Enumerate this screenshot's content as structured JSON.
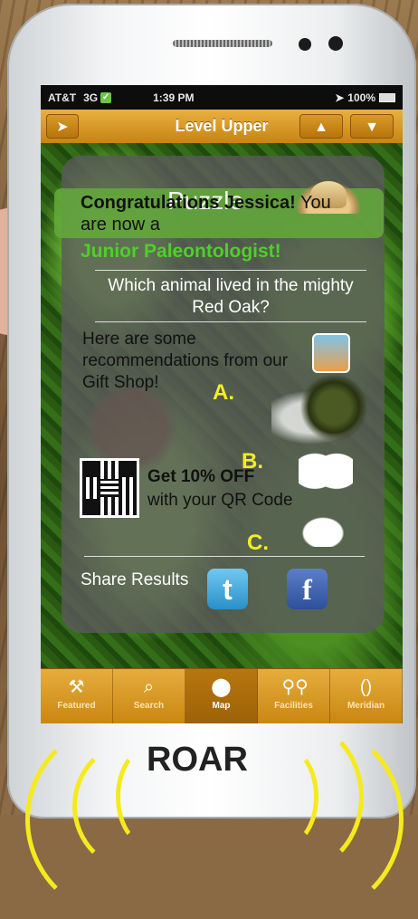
{
  "statusbar": {
    "carrier": "AT&T",
    "network": "3G",
    "time": "1:39 PM",
    "battery": "100%"
  },
  "navbar": {
    "title": "Level Upper",
    "up_arrow": "▲",
    "down_arrow": "▼",
    "location_icon": "➤"
  },
  "panel": {
    "puzzle_title": "Puzzle",
    "congrats_name": "Congratulations Jessica!",
    "congrats_rest": " You are now a",
    "achievement": "Junior Paleontologist!",
    "question": "Which animal lived in the mighty Red Oak?",
    "gift_text": "Here are some recommendations from our Gift Shop!",
    "option_a": "A.",
    "option_b": "B.",
    "option_c": "C.",
    "discount_bold": "Get 10% OFF",
    "discount_rest": "with your QR Code",
    "share_label": "Share Results",
    "twitter": "t",
    "facebook": "f"
  },
  "tabbar": {
    "items": [
      {
        "label": "Featured",
        "icon": "⚒"
      },
      {
        "label": "Search",
        "icon": "🔍"
      },
      {
        "label": "Map",
        "icon": "📍"
      },
      {
        "label": "Facilities",
        "icon": "🚻"
      },
      {
        "label": "Meridian",
        "icon": "()"
      }
    ]
  },
  "roar": {
    "label": "ROAR",
    "accent_color": "#f5ea1d"
  }
}
